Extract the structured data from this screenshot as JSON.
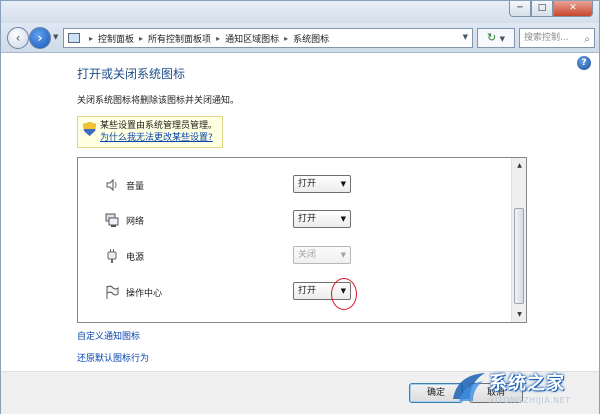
{
  "window": {
    "caption_buttons": {
      "minimize": "─",
      "maximize": "□",
      "close": "✕"
    }
  },
  "navigation": {
    "back_glyph": "‹",
    "forward_glyph": "›",
    "breadcrumbs": [
      "控制面板",
      "所有控制面板项",
      "通知区域图标",
      "系统图标"
    ],
    "crumb_separator": "▸",
    "search_placeholder": "搜索控制..."
  },
  "page": {
    "title": "打开或关闭系统图标",
    "description": "关闭系统图标将删除该图标并关闭通知。",
    "help_glyph": "?"
  },
  "info_box": {
    "text": "某些设置由系统管理员管理。",
    "link": "为什么我无法更改某些设置?"
  },
  "icon_list": {
    "rows": [
      {
        "label": "音量",
        "icon": "speaker-icon",
        "value": "打开",
        "enabled": true
      },
      {
        "label": "网络",
        "icon": "network-icon",
        "value": "打开",
        "enabled": true
      },
      {
        "label": "电源",
        "icon": "power-plug-icon",
        "value": "关闭",
        "enabled": false
      },
      {
        "label": "操作中心",
        "icon": "flag-icon",
        "value": "打开",
        "enabled": true
      }
    ]
  },
  "links": {
    "customize": "自定义通知图标",
    "restore": "还原默认图标行为"
  },
  "buttons": {
    "ok": "确定",
    "cancel": "取消"
  },
  "watermark": {
    "title": "系统之家",
    "url": "XITONGZHIJIA.NET"
  }
}
